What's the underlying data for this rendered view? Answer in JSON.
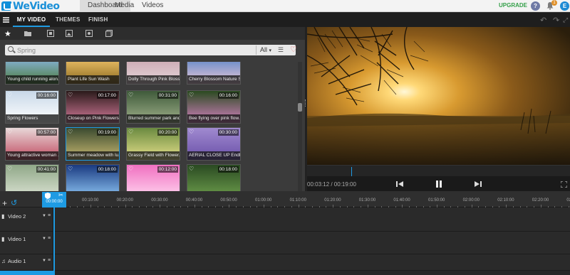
{
  "app": {
    "logo_text": "WeVideo",
    "nav": [
      "Dashboard",
      "Media",
      "Videos"
    ],
    "upgrade_label": "UPGRADE",
    "help_glyph": "?",
    "notification_count": "1",
    "avatar_initial": "E"
  },
  "tabs": [
    "MY VIDEO",
    "THEMES",
    "FINISH"
  ],
  "media": {
    "search": {
      "placeholder": "Spring",
      "filter_label": "All",
      "filter_caret": "▾"
    },
    "items": [
      {
        "title": "Young child running alon...",
        "duration": "",
        "colors": [
          "#8bb6e0",
          "#4a7a3a"
        ],
        "selected": false,
        "favorite": false
      },
      {
        "title": "Plant Life Sun Wash",
        "duration": "",
        "colors": [
          "#f1c36a",
          "#8a6a20"
        ],
        "selected": false,
        "favorite": false
      },
      {
        "title": "Dolly Through Pink Blosso...",
        "duration": "",
        "colors": [
          "#c9a6b0",
          "#e6d5d9"
        ],
        "selected": false,
        "favorite": false
      },
      {
        "title": "Cherry Blossom Nature S...",
        "duration": "",
        "colors": [
          "#5c86c8",
          "#e8c6d6"
        ],
        "selected": false,
        "favorite": false
      },
      {
        "title": "Spring Flowers",
        "duration": "00:16:00",
        "colors": [
          "#c8d8e8",
          "#ffffff"
        ],
        "selected": false,
        "favorite": true
      },
      {
        "title": "Closeup on Pink Flowers ...",
        "duration": "00:17:00",
        "colors": [
          "#2a1a1a",
          "#d47a9a"
        ],
        "selected": false,
        "favorite": true
      },
      {
        "title": "Blurred summer park and...",
        "duration": "00:31:00",
        "colors": [
          "#3f5a3a",
          "#9fb08a"
        ],
        "selected": false,
        "favorite": true
      },
      {
        "title": "Bee flying over pink flow...",
        "duration": "00:16:00",
        "colors": [
          "#2a4a20",
          "#d480c0"
        ],
        "selected": false,
        "favorite": true
      },
      {
        "title": "Young attractive woman ...",
        "duration": "00:57:00",
        "colors": [
          "#e8d8d8",
          "#c04a60"
        ],
        "selected": false,
        "favorite": true
      },
      {
        "title": "Summer meadow with lu...",
        "duration": "00:19:00",
        "colors": [
          "#3a4a30",
          "#c8b870"
        ],
        "selected": true,
        "favorite": true
      },
      {
        "title": "Grassy Field with Flower...",
        "duration": "00:20:00",
        "colors": [
          "#6a8a40",
          "#e6e08a"
        ],
        "selected": false,
        "favorite": true
      },
      {
        "title": "AERIAL CLOSE UP Endle...",
        "duration": "00:30:00",
        "colors": [
          "#a08ad0",
          "#6a50a8"
        ],
        "selected": false,
        "favorite": true
      },
      {
        "title": "",
        "duration": "00:41:00",
        "colors": [
          "#90a888",
          "#d8e0d0"
        ],
        "selected": false,
        "favorite": true
      },
      {
        "title": "",
        "duration": "00:18:00",
        "colors": [
          "#1a3a80",
          "#8ac0f0"
        ],
        "selected": false,
        "favorite": true
      },
      {
        "title": "",
        "duration": "00:12:00",
        "colors": [
          "#f070c0",
          "#ffd0ee"
        ],
        "selected": false,
        "favorite": true
      },
      {
        "title": "",
        "duration": "00:18:00",
        "colors": [
          "#2a4a22",
          "#6a9a4a"
        ],
        "selected": false,
        "favorite": true
      }
    ]
  },
  "player": {
    "time_readout": "00:03:12 / 00:19:00",
    "progress_fraction": 0.168
  },
  "timeline": {
    "playhead_time": "00:00:00",
    "ticks": [
      "00:10:00",
      "00:20:00",
      "00:30:00",
      "00:40:00",
      "00:50:00",
      "01:00:00",
      "01:10:00",
      "01:20:00",
      "01:30:00",
      "01:40:00",
      "01:50:00",
      "02:00:00",
      "02:10:00",
      "02:20:00",
      "02:30:00"
    ],
    "tracks": [
      {
        "name": "Video 2",
        "type": "video"
      },
      {
        "name": "Video 1",
        "type": "video"
      },
      {
        "name": "Audio 1",
        "type": "audio"
      }
    ]
  },
  "colors": {
    "accent": "#1e9be3",
    "upgrade": "#35a04a",
    "panel": "#3b3b3b",
    "timeline": "#262626"
  },
  "icons": [
    "menu-icon",
    "star-icon",
    "folder-icon",
    "search-icon",
    "sliders-icon",
    "heart-icon",
    "help-icon",
    "bell-icon",
    "undo-icon",
    "redo-icon",
    "prev-icon",
    "pause-icon",
    "next-icon",
    "fullscreen-icon",
    "add-track-icon",
    "film-icon",
    "music-icon"
  ]
}
